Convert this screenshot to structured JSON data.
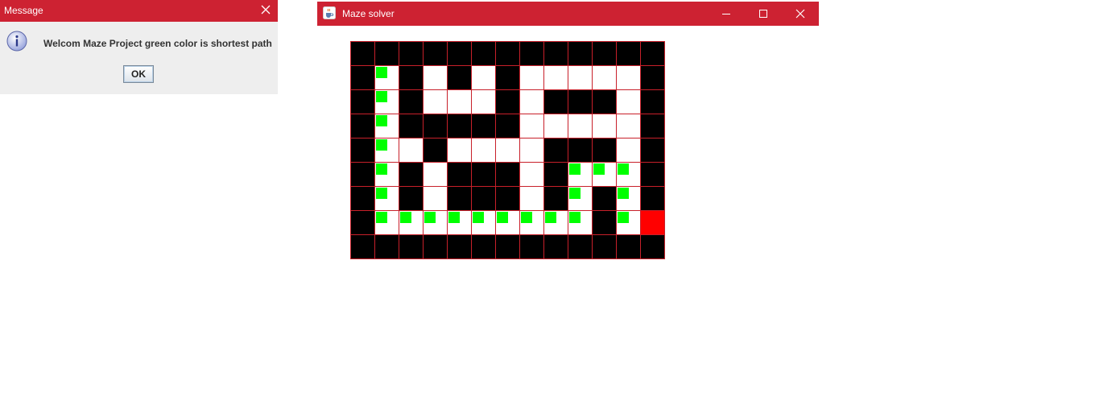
{
  "message_dialog": {
    "title": "Message",
    "icon": "info-icon",
    "text": "Welcom Maze Project green color is shortest path",
    "ok_label": "OK"
  },
  "maze_window": {
    "title": "Maze solver",
    "controls": [
      "minimize-icon",
      "maximize-icon",
      "close-icon"
    ]
  },
  "maze": {
    "legend": {
      "1": "wall",
      "0": "open",
      "2": "shortest-path",
      "9": "goal"
    },
    "colors": {
      "wall": "#000000",
      "open": "#ffffff",
      "path": "#00ff00",
      "goal": "#ff0000",
      "grid": "#c8202a"
    },
    "grid": [
      [
        1,
        1,
        1,
        1,
        1,
        1,
        1,
        1,
        1,
        1,
        1,
        1,
        1
      ],
      [
        1,
        2,
        1,
        0,
        1,
        0,
        1,
        0,
        0,
        0,
        0,
        0,
        1
      ],
      [
        1,
        2,
        1,
        0,
        0,
        0,
        1,
        0,
        1,
        1,
        1,
        0,
        1
      ],
      [
        1,
        2,
        1,
        1,
        1,
        1,
        1,
        0,
        0,
        0,
        0,
        0,
        1
      ],
      [
        1,
        2,
        0,
        1,
        0,
        0,
        0,
        0,
        1,
        1,
        1,
        0,
        1
      ],
      [
        1,
        2,
        1,
        0,
        1,
        1,
        1,
        0,
        1,
        2,
        2,
        2,
        1
      ],
      [
        1,
        2,
        1,
        0,
        1,
        1,
        1,
        0,
        1,
        2,
        1,
        2,
        1
      ],
      [
        1,
        2,
        2,
        2,
        2,
        2,
        2,
        2,
        2,
        2,
        1,
        2,
        9
      ],
      [
        1,
        1,
        1,
        1,
        1,
        1,
        1,
        1,
        1,
        1,
        1,
        1,
        1
      ]
    ]
  },
  "theme": {
    "titlebar": "#cd2232",
    "dialog_bg": "#eeeeee"
  }
}
